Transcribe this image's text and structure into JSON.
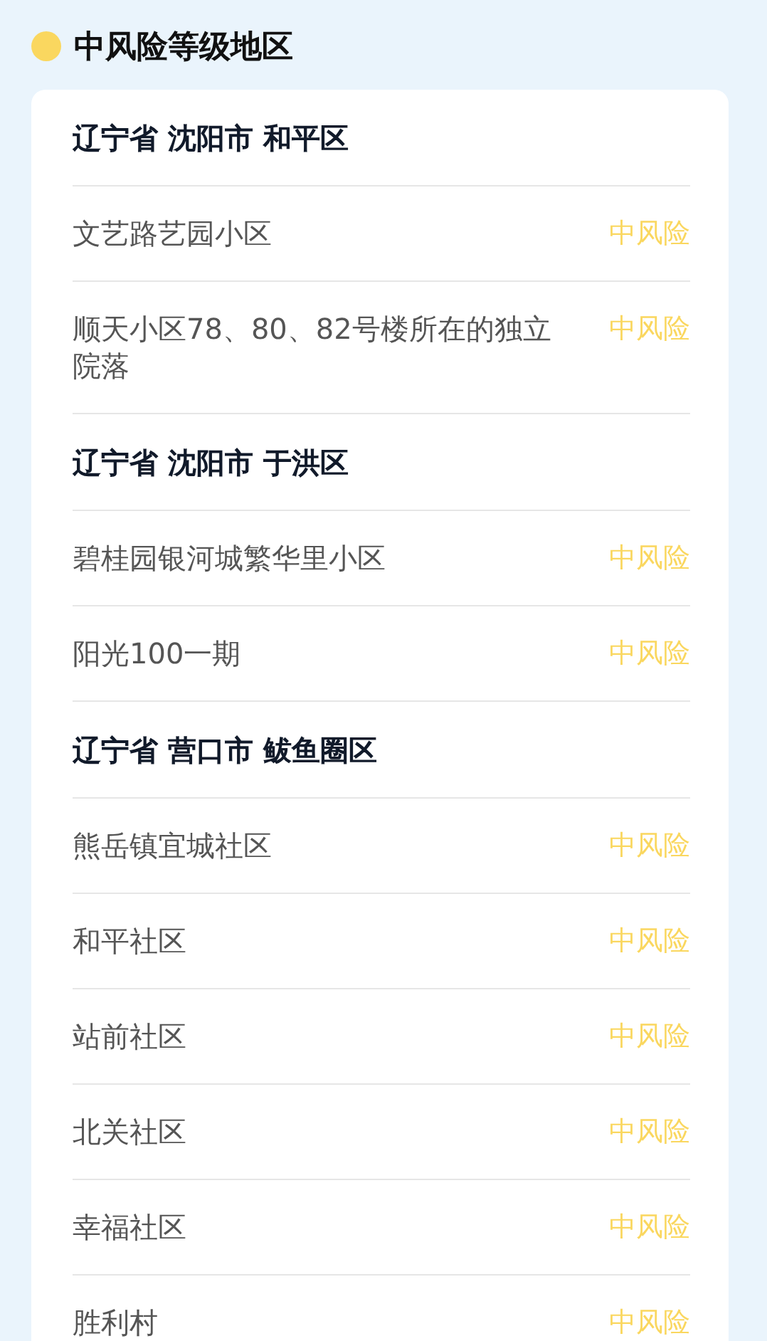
{
  "section": {
    "title": "中风险等级地区",
    "color": "#fad75f"
  },
  "groups": [
    {
      "region": "辽宁省 沈阳市 和平区",
      "items": [
        {
          "name": "文艺路艺园小区",
          "risk": "中风险"
        },
        {
          "name": "顺天小区78、80、82号楼所在的独立院落",
          "risk": "中风险"
        }
      ]
    },
    {
      "region": "辽宁省 沈阳市 于洪区",
      "items": [
        {
          "name": "碧桂园银河城繁华里小区",
          "risk": "中风险"
        },
        {
          "name": "阳光100一期",
          "risk": "中风险"
        }
      ]
    },
    {
      "region": "辽宁省 营口市 鲅鱼圈区",
      "items": [
        {
          "name": "熊岳镇宜城社区",
          "risk": "中风险"
        },
        {
          "name": "和平社区",
          "risk": "中风险"
        },
        {
          "name": "站前社区",
          "risk": "中风险"
        },
        {
          "name": "北关社区",
          "risk": "中风险"
        },
        {
          "name": "幸福社区",
          "risk": "中风险"
        },
        {
          "name": "胜利村",
          "risk": "中风险"
        }
      ]
    }
  ]
}
